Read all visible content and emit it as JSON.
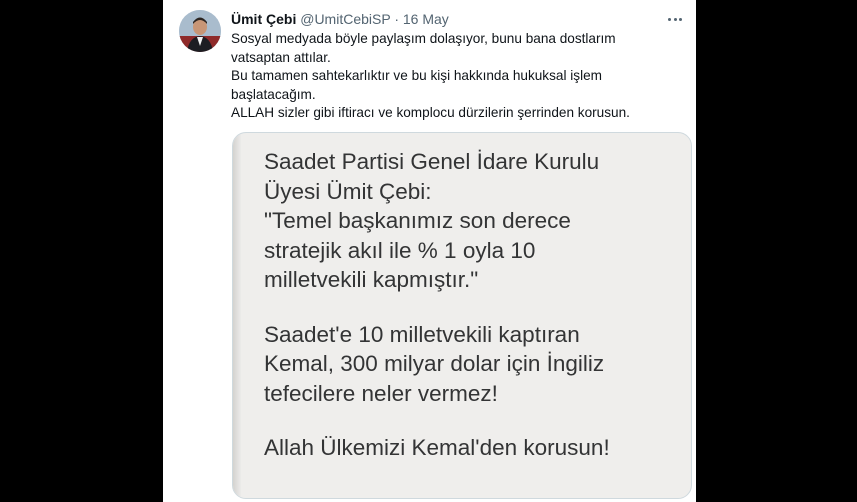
{
  "tweet": {
    "author_name": "Ümit Çebi",
    "handle": "@UmitCebiSP",
    "separator": "·",
    "date": "16 May",
    "lines": [
      "Sosyal medyada böyle paylaşım dolaşıyor, bunu bana dostlarım",
      "vatsaptan attılar.",
      "Bu tamamen sahtekarlıktır ve bu kişi hakkında hukuksal işlem",
      "başlatacağım.",
      "ALLAH sizler gibi iftiracı ve komplocu dürzilerin şerrinden korusun."
    ],
    "more_icon": "more-horizontal-icon"
  },
  "media": {
    "paragraphs": [
      [
        "Saadet Partisi Genel İdare Kurulu",
        "Üyesi Ümit Çebi:",
        "\"Temel başkanımız son derece",
        "stratejik akıl ile % 1 oyla 10",
        "milletvekili kapmıştır.\""
      ],
      [
        "Saadet'e 10 milletvekili kaptıran",
        "Kemal, 300 milyar dolar için İngiliz",
        "tefecilere neler vermez!"
      ],
      [
        "Allah Ülkemizi Kemal'den korusun!"
      ]
    ]
  },
  "colors": {
    "background": "#000000",
    "card": "#ffffff",
    "text": "#0f1419",
    "secondary": "#536471",
    "media_bg": "#efeeec",
    "media_text": "#333435"
  }
}
